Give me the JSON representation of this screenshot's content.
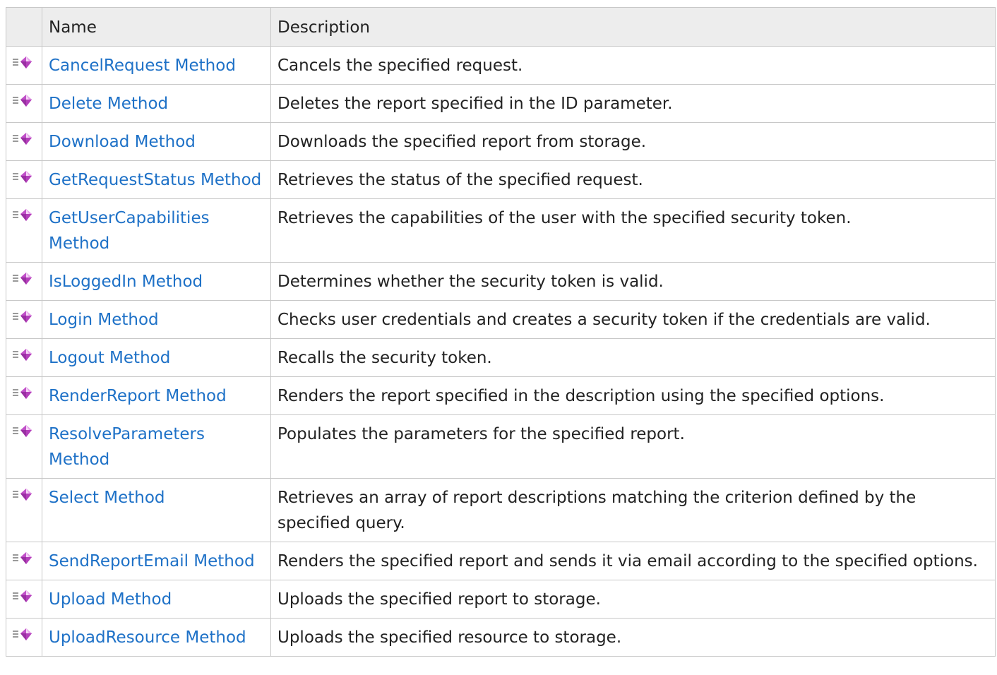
{
  "table": {
    "headers": {
      "icon": "",
      "name": "Name",
      "description": "Description"
    },
    "icon_name": "public-method-icon",
    "colors": {
      "link": "#1e71c7",
      "header_bg": "#ededed",
      "border": "#c8c8c8",
      "icon_diamond": "#c050c8"
    },
    "rows": [
      {
        "name": "CancelRequest Method",
        "description": "Cancels the specified request."
      },
      {
        "name": "Delete Method",
        "description": "Deletes the report specified in the ID parameter."
      },
      {
        "name": "Download Method",
        "description": "Downloads the specified report from storage."
      },
      {
        "name": "GetRequestStatus Method",
        "description": "Retrieves the status of the specified request."
      },
      {
        "name": "GetUserCapabilities Method",
        "description": "Retrieves the capabilities of the user with the specified security token."
      },
      {
        "name": "IsLoggedIn Method",
        "description": "Determines whether the security token is valid."
      },
      {
        "name": "Login Method",
        "description": "Checks user credentials and creates a security token if the credentials are valid."
      },
      {
        "name": "Logout Method",
        "description": "Recalls the security token."
      },
      {
        "name": "RenderReport Method",
        "description": "Renders the report specified in the description using the specified options."
      },
      {
        "name": "ResolveParameters Method",
        "description": "Populates the parameters for the specified report."
      },
      {
        "name": "Select Method",
        "description": "Retrieves an array of report descriptions matching the criterion defined by the specified query."
      },
      {
        "name": "SendReportEmail Method",
        "description": "Renders the specified report and sends it via email according to the specified options."
      },
      {
        "name": "Upload Method",
        "description": "Uploads the specified report to storage."
      },
      {
        "name": "UploadResource Method",
        "description": "Uploads the specified resource to storage."
      }
    ]
  }
}
